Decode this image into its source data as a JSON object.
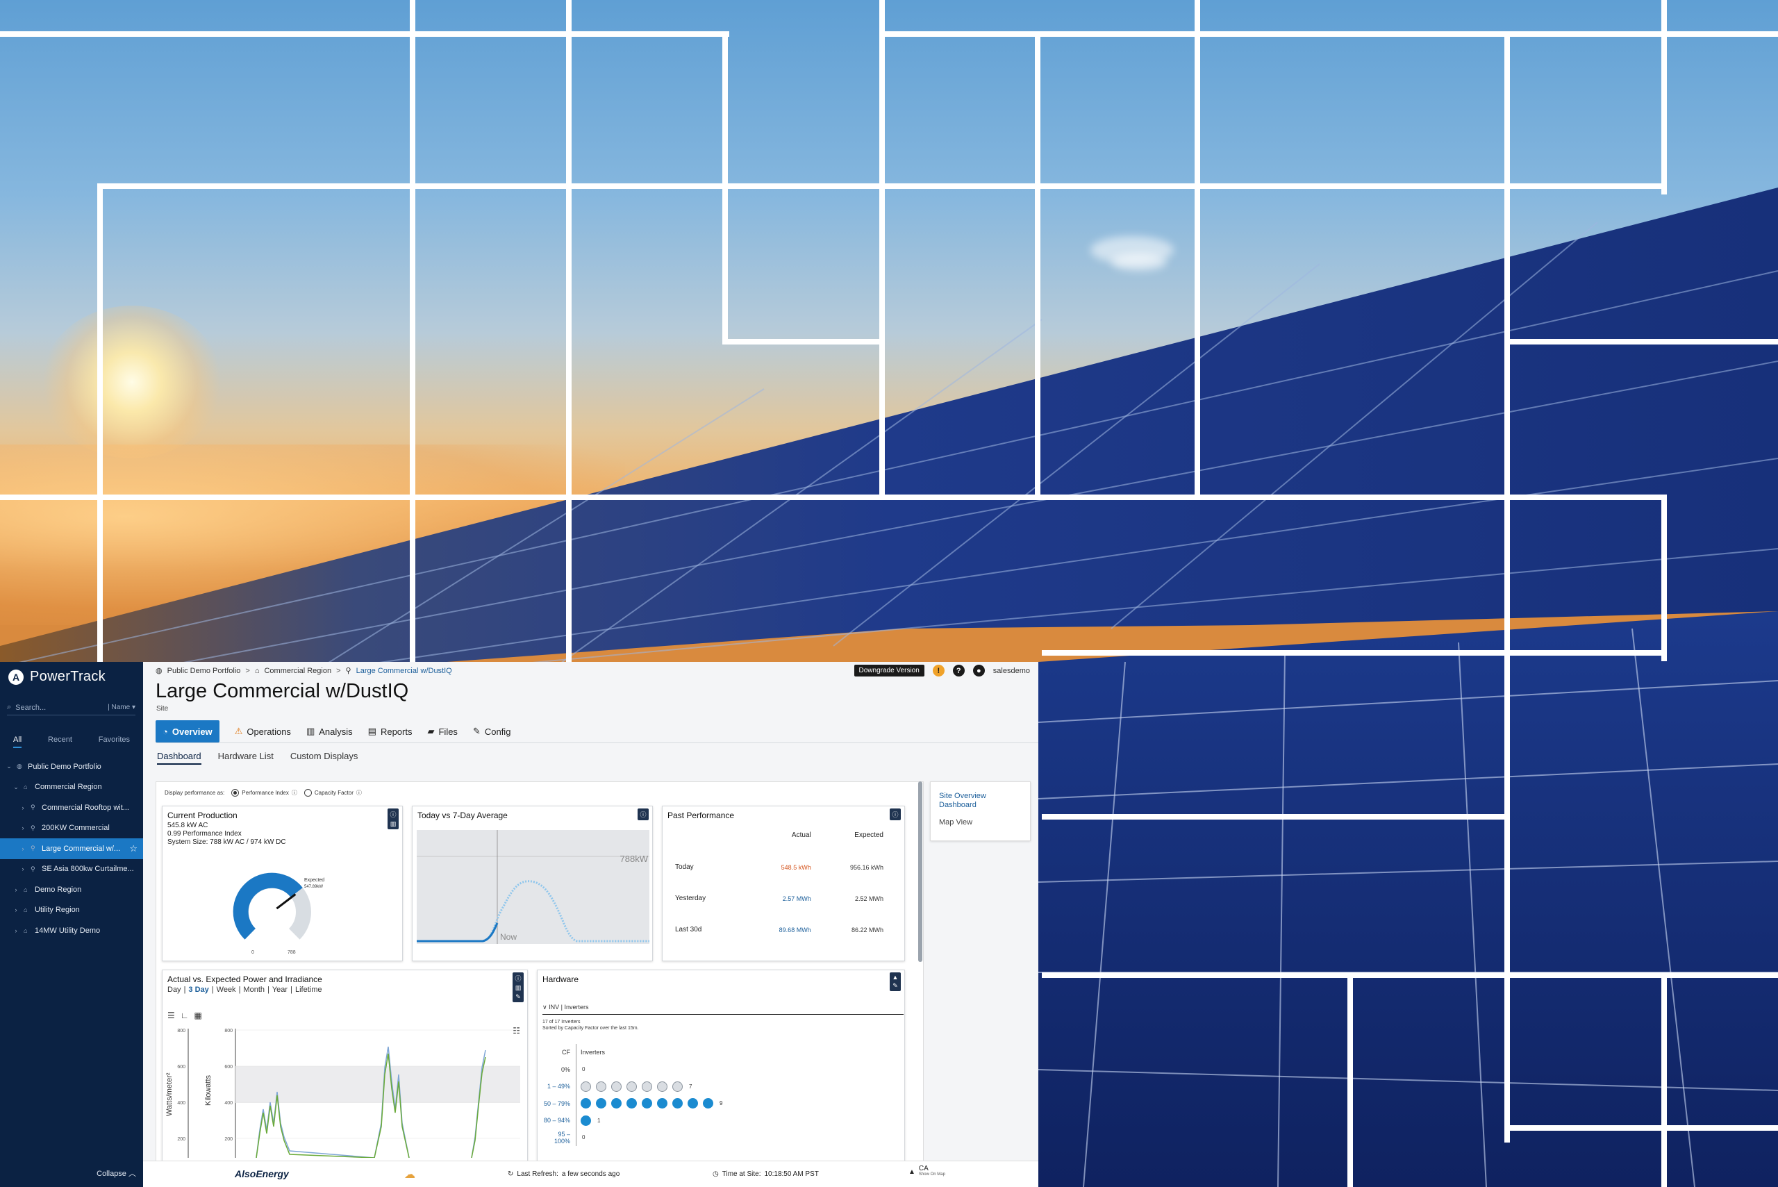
{
  "app": {
    "brand": "PowerTrack",
    "search_placeholder": "Search...",
    "sort_label": "Name",
    "sidebar_tabs": [
      "All",
      "Recent",
      "Favorites"
    ],
    "tree": [
      {
        "label": "Public Demo Portfolio",
        "level": 0,
        "expanded": true
      },
      {
        "label": "Commercial Region",
        "level": 1,
        "expanded": true
      },
      {
        "label": "Commercial Rooftop wit...",
        "level": 2
      },
      {
        "label": "200KW Commercial",
        "level": 2
      },
      {
        "label": "Large Commercial w/...",
        "level": 2,
        "selected": true
      },
      {
        "label": "SE Asia 800kw Curtailme...",
        "level": 2
      },
      {
        "label": "Demo Region",
        "level": 1
      },
      {
        "label": "Utility Region",
        "level": 1
      },
      {
        "label": "14MW Utility Demo",
        "level": 1
      }
    ],
    "collapse_label": "Collapse"
  },
  "header": {
    "breadcrumbs": [
      "Public Demo Portfolio",
      "Commercial Region",
      "Large Commercial w/DustIQ"
    ],
    "downgrade_label": "Downgrade Version",
    "user": "salesdemo",
    "title": "Large Commercial w/DustIQ",
    "subtitle": "Site"
  },
  "nav_tabs": [
    "Overview",
    "Operations",
    "Analysis",
    "Reports",
    "Files",
    "Config"
  ],
  "sub_tabs": [
    "Dashboard",
    "Hardware List",
    "Custom Displays"
  ],
  "dashboard": {
    "display_perf_label": "Display performance as:",
    "perf_options": [
      "Performance Index",
      "Capacity Factor"
    ],
    "current_production": {
      "title": "Current Production",
      "lines": [
        "545.8 kW AC",
        "0.99 Performance Index",
        "System Size: 788 kW AC / 974 kW DC"
      ],
      "gauge_expected": "Expected",
      "gauge_expected_value": "547.89kW",
      "gauge_min": "0",
      "gauge_max": "788",
      "gauge_fraction": 0.69,
      "gauge_expected_fraction": 0.695
    },
    "today_vs_avg": {
      "title": "Today vs 7-Day Average",
      "max_label": "788kW",
      "now_label": "Now"
    },
    "past_performance": {
      "title": "Past Performance",
      "col_actual": "Actual",
      "col_expected": "Expected",
      "rows": [
        {
          "label": "Today",
          "actual": "548.5 kWh",
          "expected": "956.16 kWh"
        },
        {
          "label": "Yesterday",
          "actual": "2.57 MWh",
          "expected": "2.52 MWh"
        },
        {
          "label": "Last 30d",
          "actual": "89.68 MWh",
          "expected": "86.22 MWh"
        }
      ]
    },
    "actual_vs_expected": {
      "title": "Actual vs. Expected Power and Irradiance",
      "ranges": [
        "Day",
        "3 Day",
        "Week",
        "Month",
        "Year",
        "Lifetime"
      ],
      "active_range": "3 Day",
      "y_left_label": "Watts/meter²",
      "y_right_label": "Kilowatts",
      "ticks": [
        "800",
        "600",
        "400",
        "200"
      ]
    },
    "hardware": {
      "title": "Hardware",
      "section": "INV",
      "section_label": "Inverters",
      "note_1": "17 of 17 Inverters",
      "note_2": "Sorted by Capacity Factor over the last 15m.",
      "col_cf": "CF",
      "col_inv": "Inverters",
      "rows": [
        {
          "label": "0%",
          "count": "0",
          "n": 0,
          "color": "none"
        },
        {
          "label": "1 – 49%",
          "count": "7",
          "n": 7,
          "color": "grey"
        },
        {
          "label": "50 – 79%",
          "count": "9",
          "n": 9,
          "color": "blue"
        },
        {
          "label": "80 – 94%",
          "count": "1",
          "n": 1,
          "color": "blue"
        },
        {
          "label": "95 – 100%",
          "count": "0",
          "n": 0,
          "color": "none"
        }
      ]
    },
    "side_panel": {
      "link": "Site Overview Dashboard",
      "map": "Map View"
    }
  },
  "footer": {
    "logo": "AlsoEnergy",
    "refresh_label": "Last Refresh:",
    "refresh_value": "a few seconds ago",
    "time_label": "Time at Site:",
    "time_value": "10:18:50 AM PST",
    "region": "CA",
    "region_sub": "Show On Map"
  }
}
